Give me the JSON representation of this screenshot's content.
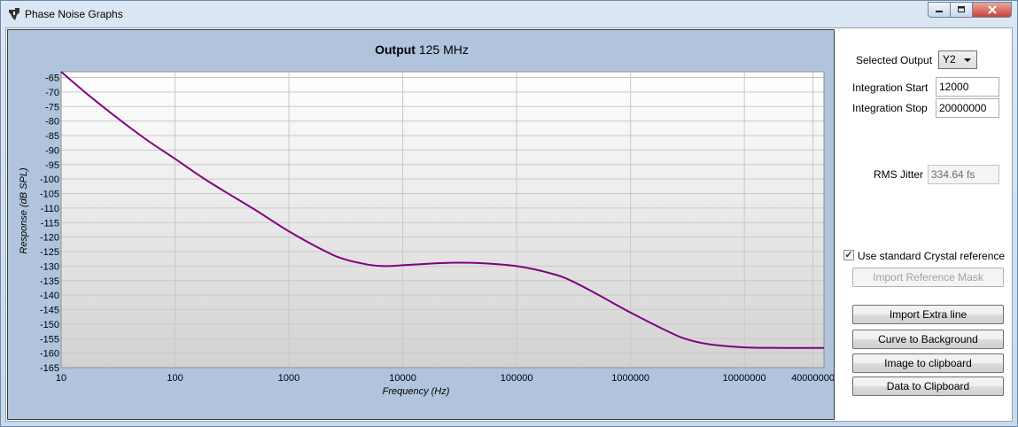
{
  "window": {
    "title": "Phase Noise Graphs"
  },
  "chart": {
    "title_bold": "Output",
    "title_rest": "125 MHz"
  },
  "chart_data": {
    "type": "line",
    "xlabel": "Frequency (Hz)",
    "ylabel": "Response (dB SPL)",
    "x_scale": "log",
    "xlim": [
      10,
      50000000
    ],
    "ylim": [
      -165,
      -63
    ],
    "x_ticks": [
      10,
      100,
      1000,
      10000,
      100000,
      1000000,
      10000000,
      40000000
    ],
    "x_tick_labels": [
      "10",
      "100",
      "1000",
      "10000",
      "100000",
      "1000000",
      "10000000",
      "40000000"
    ],
    "y_ticks": [
      -65,
      -70,
      -75,
      -80,
      -85,
      -90,
      -95,
      -100,
      -105,
      -110,
      -115,
      -120,
      -125,
      -130,
      -135,
      -140,
      -145,
      -150,
      -155,
      -160,
      -165
    ],
    "y_tick_labels": [
      "-65",
      "-70",
      "-75",
      "-80",
      "-85",
      "-90",
      "-95",
      "-100",
      "-105",
      "-110",
      "-115",
      "-120",
      "-125",
      "-130",
      "-135",
      "-140",
      "-145",
      "-150",
      "-155",
      "-160",
      "-165"
    ],
    "grid": true,
    "series": [
      {
        "color": "#800080",
        "x": [
          10,
          20,
          50,
          100,
          200,
          500,
          1000,
          2000,
          3000,
          5000,
          7000,
          10000,
          20000,
          30000,
          50000,
          100000,
          200000,
          300000,
          500000,
          1000000,
          2000000,
          3000000,
          5000000,
          10000000,
          20000000,
          50000000
        ],
        "y": [
          -63,
          -73,
          -85,
          -93,
          -101,
          -110.5,
          -118,
          -124.5,
          -127.5,
          -129.5,
          -130,
          -129.7,
          -129,
          -128.8,
          -129,
          -130,
          -132.5,
          -135,
          -139.5,
          -146,
          -152,
          -155,
          -157,
          -158,
          -158.2,
          -158.2
        ]
      }
    ]
  },
  "side": {
    "selected_output_label": "Selected Output",
    "selected_output_value": "Y2",
    "integration_start_label": "Integration Start",
    "integration_start_value": "12000",
    "integration_stop_label": "Integration Stop",
    "integration_stop_value": "20000000",
    "rms_jitter_label": "RMS Jitter",
    "rms_jitter_value": "334.64 fs",
    "use_crystal_label": "Use standard Crystal reference",
    "use_crystal_checked": true,
    "import_mask_label": "Import Reference Mask",
    "import_extra_label": "Import Extra line",
    "curve_bg_label": "Curve to Background",
    "image_clip_label": "Image to clipboard",
    "data_clip_label": "Data to Clipboard"
  },
  "colors": {
    "plot_bg_top": "#ffffff",
    "plot_bg_bottom": "#d0d0d0",
    "panel_bg": "#b0c4de",
    "curve": "#800080"
  }
}
